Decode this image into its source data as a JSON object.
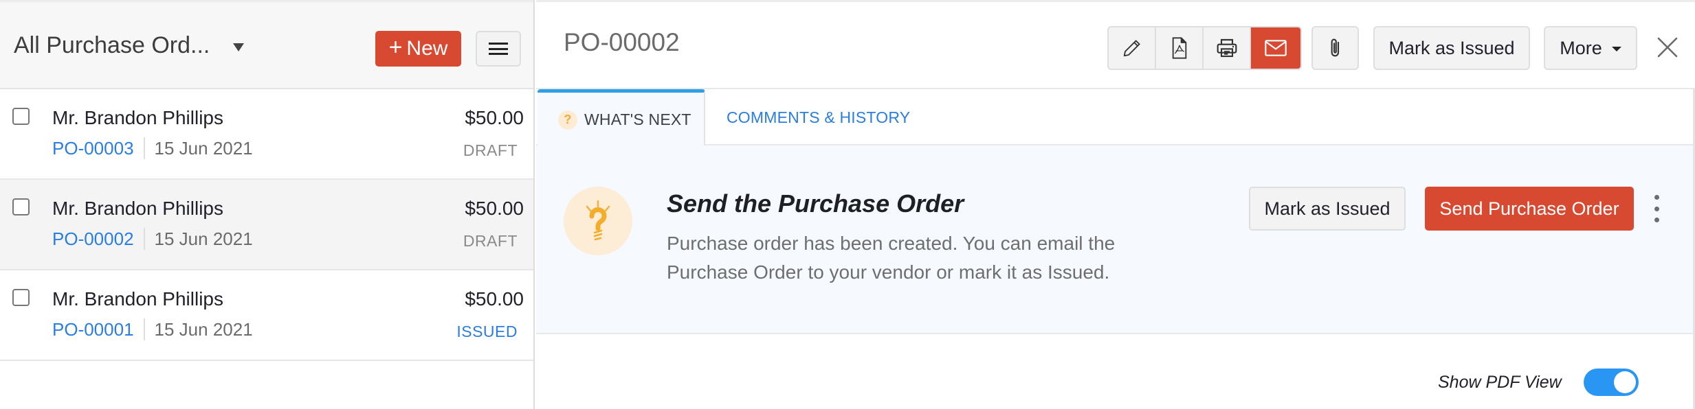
{
  "list": {
    "title": "All Purchase Ord...",
    "new_button": "New",
    "rows": [
      {
        "name": "Mr. Brandon Phillips",
        "po": "PO-00003",
        "date": "15 Jun 2021",
        "amount": "$50.00",
        "status": "DRAFT"
      },
      {
        "name": "Mr. Brandon Phillips",
        "po": "PO-00002",
        "date": "15 Jun 2021",
        "amount": "$50.00",
        "status": "DRAFT"
      },
      {
        "name": "Mr. Brandon Phillips",
        "po": "PO-00001",
        "date": "15 Jun 2021",
        "amount": "$50.00",
        "status": "ISSUED"
      }
    ]
  },
  "detail": {
    "title": "PO-00002",
    "toolbar": {
      "icons": [
        "pencil-icon",
        "pdf-icon",
        "printer-icon",
        "mail-icon",
        "paperclip-icon"
      ],
      "mark_issued": "Mark as Issued",
      "more": "More"
    },
    "tabs": [
      {
        "label": "WHAT'S NEXT",
        "active": true
      },
      {
        "label": "COMMENTS & HISTORY",
        "active": false
      }
    ],
    "whats_next": {
      "title": "Send the Purchase Order",
      "description": "Purchase order has been created. You can email the Purchase Order to your vendor or mark it as Issued.",
      "mark_issued": "Mark as Issued",
      "send": "Send Purchase Order"
    },
    "pdf_view": {
      "label": "Show PDF View",
      "enabled": true
    }
  },
  "colors": {
    "brand_red": "#d74931",
    "link_blue": "#2a7de1",
    "tab_accent": "#2f9fe6",
    "toggle_on": "#2a96f3"
  }
}
